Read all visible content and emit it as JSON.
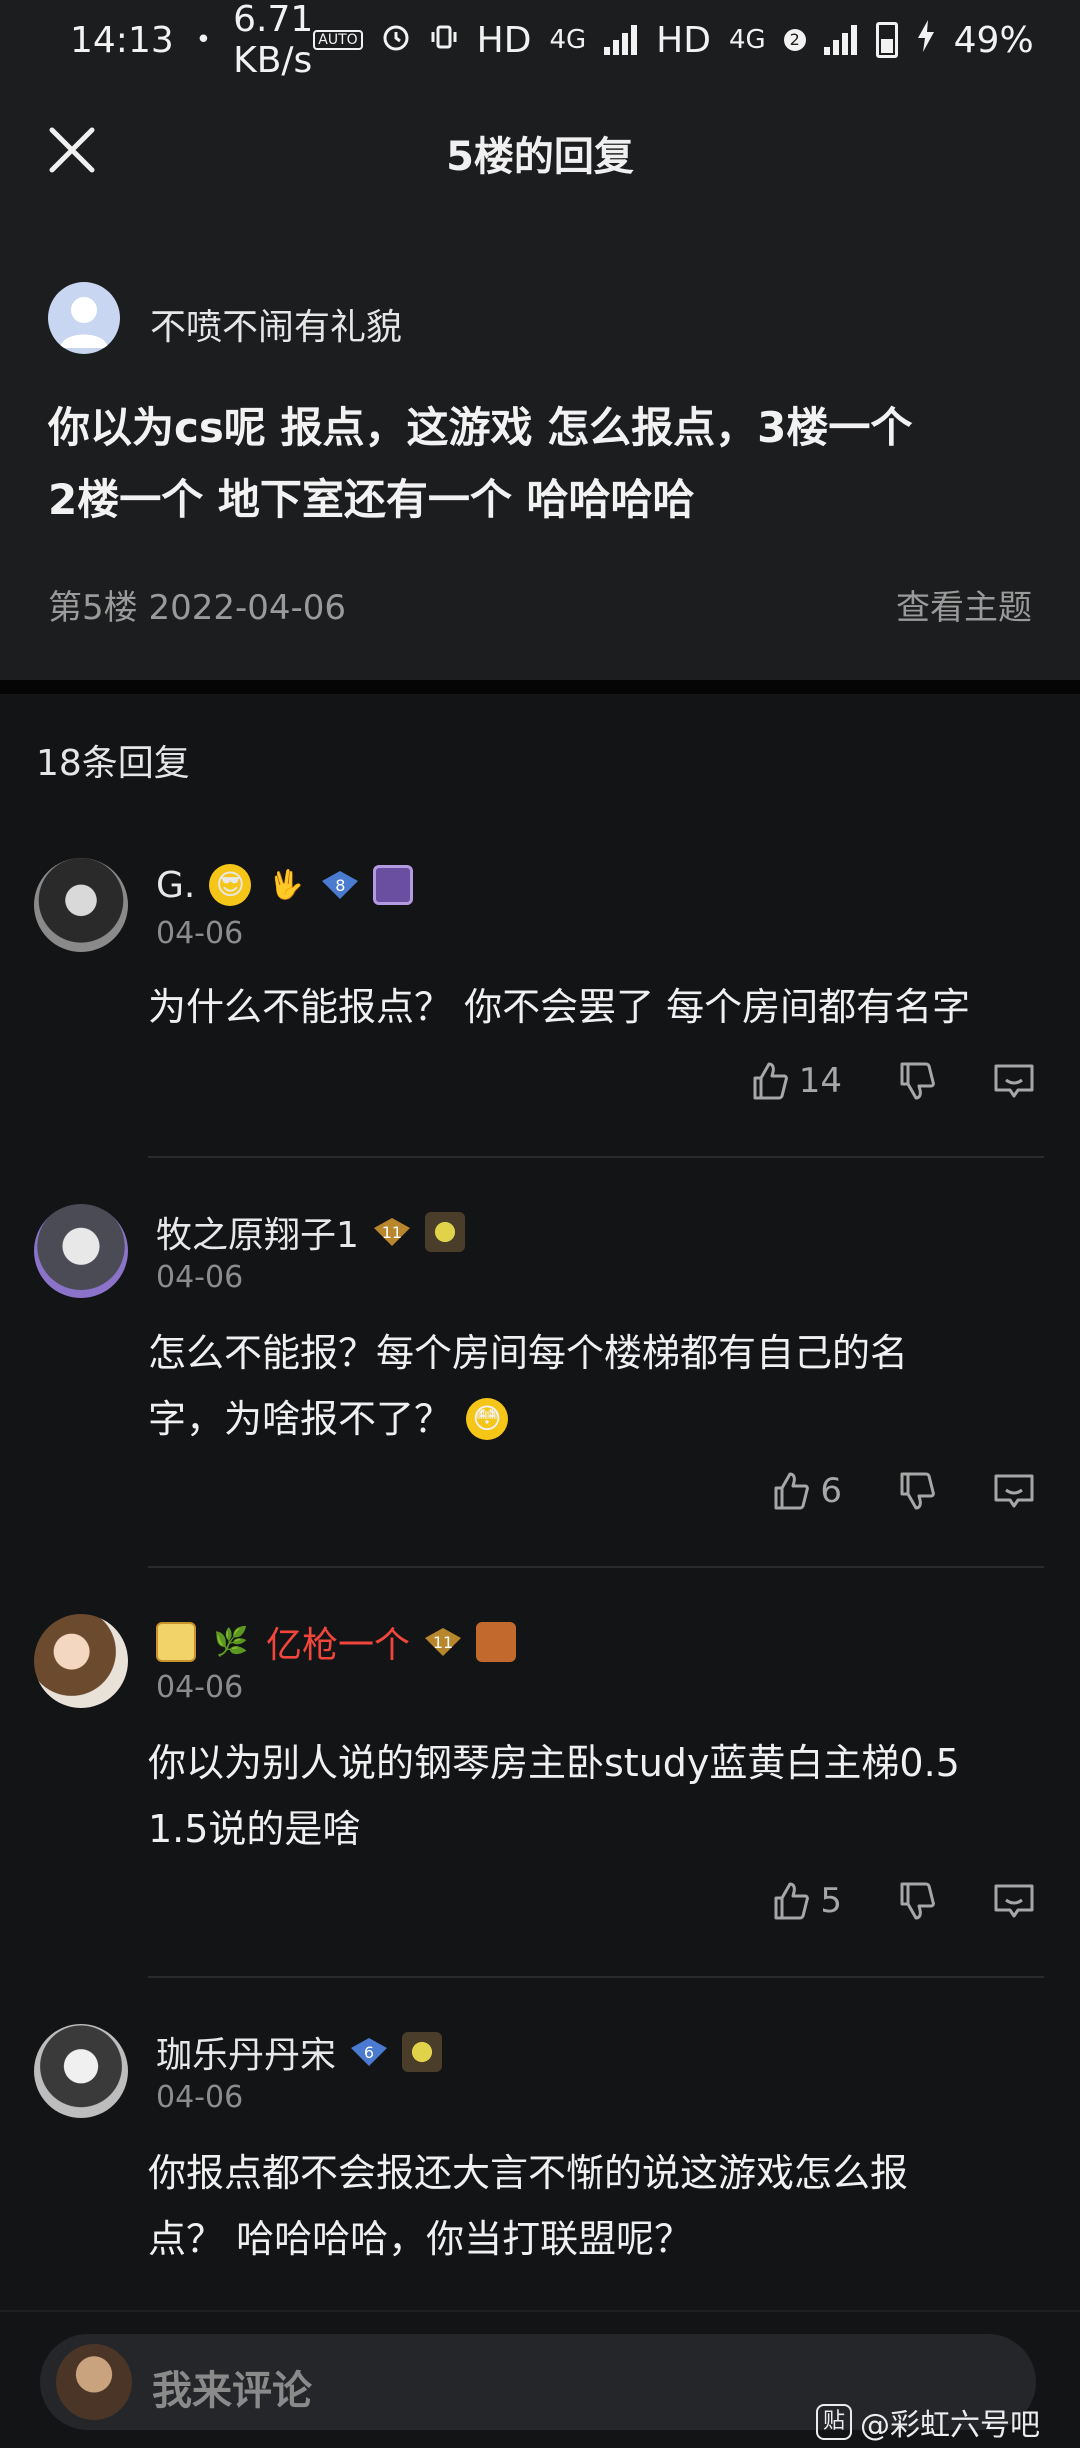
{
  "status_bar": {
    "time": "14:13",
    "dot": "•",
    "speed": "6.71 KB/s",
    "auto": "AUTO",
    "hd1": "HD",
    "net1": "4G",
    "hd2": "HD",
    "net2": "4G",
    "sim2": "2",
    "battery": "49%"
  },
  "nav": {
    "title": "5楼的回复"
  },
  "op": {
    "username": "不喷不闹有礼貌",
    "text_line1": "你以为cs呢 报点，这游戏 怎么报点，3楼一个",
    "text_line2": "2楼一个 地下室还有一个 哈哈哈哈",
    "meta": "第5楼  2022-04-06",
    "view_topic": "查看主题"
  },
  "reply_count": "18条回复",
  "replies": [
    {
      "name": "G.",
      "level": "8",
      "date": "04-06",
      "text_line1": "为什么不能报点？ 你不会罢了 每个房间都有名字",
      "text_line2": "",
      "likes": "14"
    },
    {
      "name": "牧之原翔子1",
      "level": "11",
      "date": "04-06",
      "text_line1": "怎么不能报？每个房间每个楼梯都有自己的名",
      "text_line2": "字，为啥报不了？",
      "likes": "6"
    },
    {
      "name": "亿枪一个",
      "level": "11",
      "date": "04-06",
      "text_line1": "你以为别人说的钢琴房主卧study蓝黄白主梯0.5",
      "text_line2": "1.5说的是啥",
      "likes": "5"
    },
    {
      "name": "珈乐丹丹宋",
      "level": "6",
      "date": "04-06",
      "text_line1": "你报点都不会报还大言不惭的说这游戏怎么报",
      "text_line2": "点？ 哈哈哈哈，你当打联盟呢？",
      "likes": ""
    }
  ],
  "composer": {
    "placeholder": "我来评论"
  },
  "watermark": {
    "logo": "贴",
    "text": "@彩虹六号吧"
  },
  "colors": {
    "background": "#121416",
    "panel": "#1c1d1f",
    "vip_name": "#f2463c"
  }
}
